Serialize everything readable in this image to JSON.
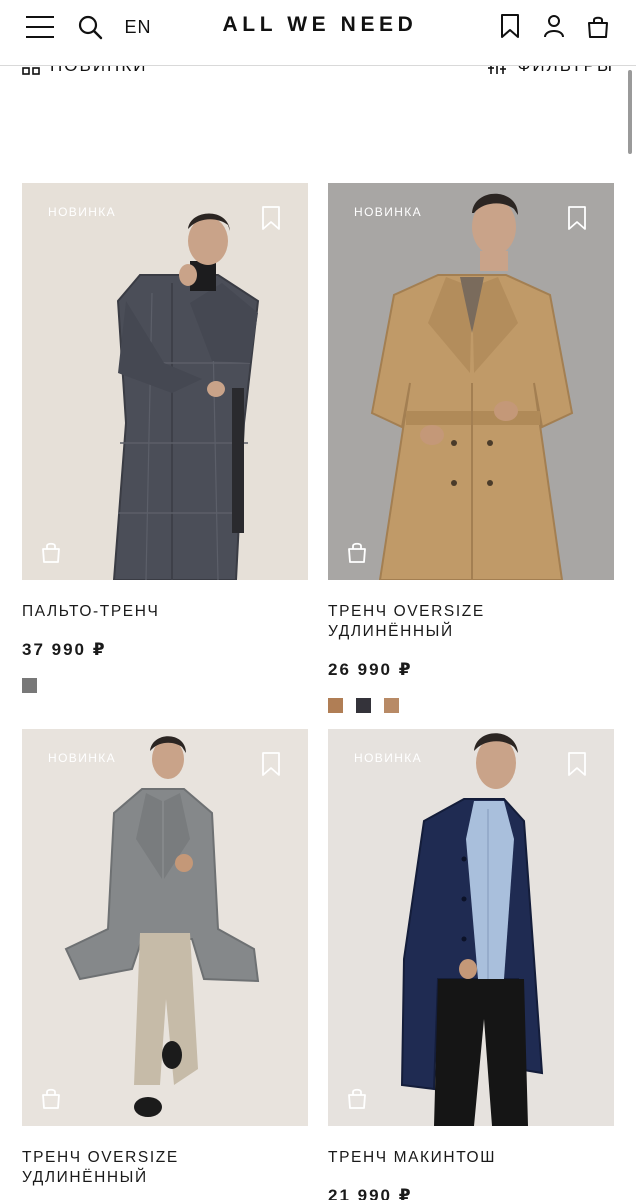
{
  "header": {
    "logo": "ALL WE NEED",
    "lang": "EN"
  },
  "filterbar": {
    "new_label": "НОВИНКИ",
    "filters_label": "ФИЛЬТРЫ"
  },
  "products": [
    {
      "badge": "НОВИНКА",
      "title": "ПАЛЬТО-ТРЕНЧ",
      "price": "37 990 ₽",
      "swatches": [
        "#787878"
      ]
    },
    {
      "badge": "НОВИНКА",
      "title_line1": "ТРЕНЧ OVERSIZE",
      "title_line2": "УДЛИНЁННЫЙ",
      "price": "26 990 ₽",
      "swatches": [
        "#b07e55",
        "#34333a",
        "#b88a66"
      ]
    },
    {
      "badge": "НОВИНКА",
      "title_line1": "ТРЕНЧ OVERSIZE",
      "title_line2": "УДЛИНЁННЫЙ",
      "price": "",
      "swatches": []
    },
    {
      "badge": "НОВИНКА",
      "title": "ТРЕНЧ МАКИНТОШ",
      "price": "21 990 ₽",
      "swatches": []
    }
  ],
  "icons": {
    "menu": "menu-icon",
    "search": "search-icon",
    "bookmark": "bookmark-icon",
    "user": "user-icon",
    "bag": "shopping-bag-icon",
    "grid": "grid-icon",
    "filters": "filters-icon"
  }
}
